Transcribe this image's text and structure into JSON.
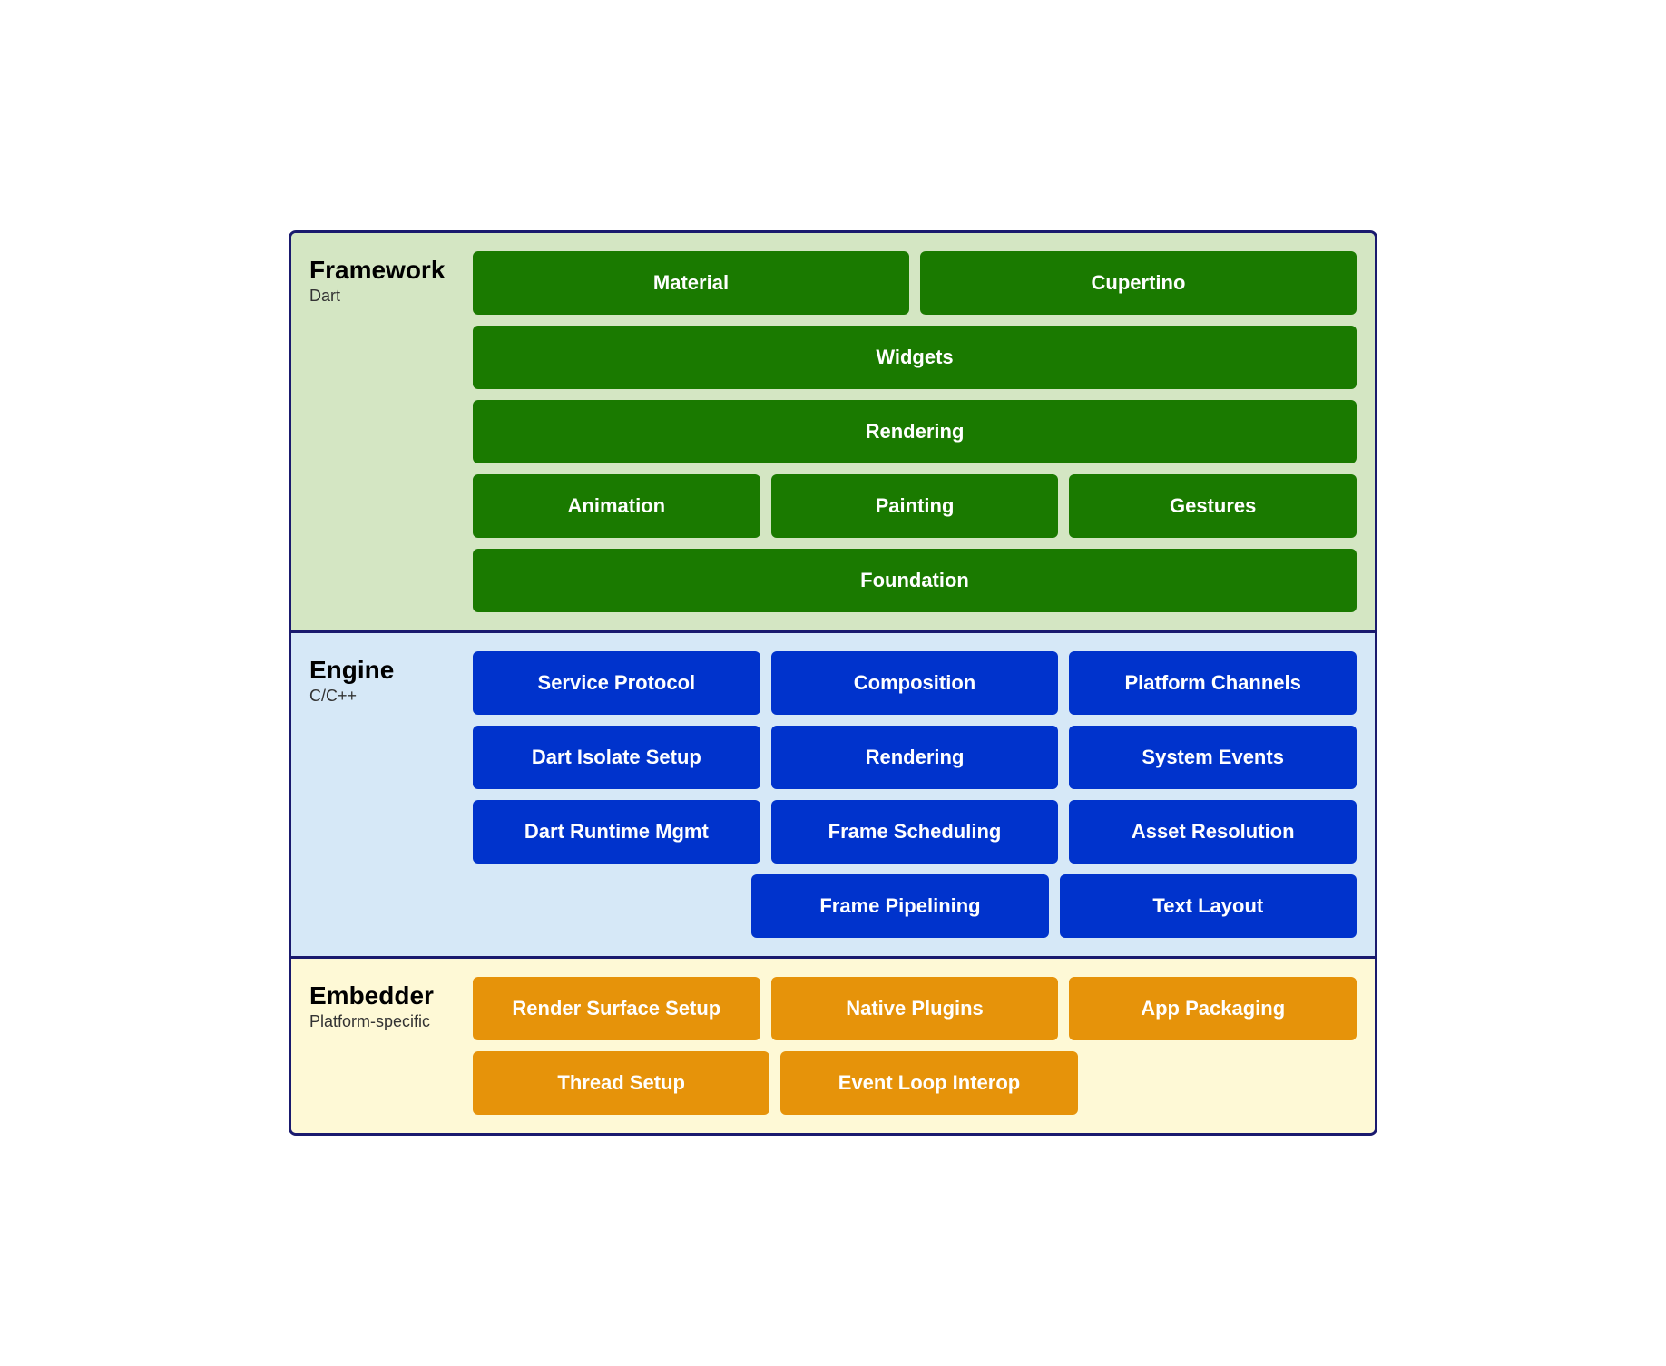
{
  "framework": {
    "title": "Framework",
    "subtitle": "Dart",
    "rows": [
      [
        {
          "label": "Material",
          "span": 1
        },
        {
          "label": "Cupertino",
          "span": 1
        }
      ],
      [
        {
          "label": "Widgets",
          "span": 2
        }
      ],
      [
        {
          "label": "Rendering",
          "span": 2
        }
      ],
      [
        {
          "label": "Animation",
          "span": 1
        },
        {
          "label": "Painting",
          "span": 1
        },
        {
          "label": "Gestures",
          "span": 1
        }
      ],
      [
        {
          "label": "Foundation",
          "span": 2
        }
      ]
    ]
  },
  "engine": {
    "title": "Engine",
    "subtitle": "C/C++",
    "rows": [
      [
        {
          "label": "Service Protocol"
        },
        {
          "label": "Composition"
        },
        {
          "label": "Platform Channels"
        }
      ],
      [
        {
          "label": "Dart Isolate Setup"
        },
        {
          "label": "Rendering"
        },
        {
          "label": "System Events"
        }
      ],
      [
        {
          "label": "Dart Runtime Mgmt"
        },
        {
          "label": "Frame Scheduling"
        },
        {
          "label": "Asset Resolution"
        }
      ],
      [
        {
          "label": ""
        },
        {
          "label": "Frame Pipelining"
        },
        {
          "label": "Text Layout"
        }
      ]
    ]
  },
  "embedder": {
    "title": "Embedder",
    "subtitle": "Platform-specific",
    "rows": [
      [
        {
          "label": "Render Surface Setup"
        },
        {
          "label": "Native Plugins"
        },
        {
          "label": "App Packaging"
        }
      ],
      [
        {
          "label": "Thread Setup"
        },
        {
          "label": "Event Loop Interop"
        },
        {
          "label": ""
        }
      ]
    ]
  }
}
